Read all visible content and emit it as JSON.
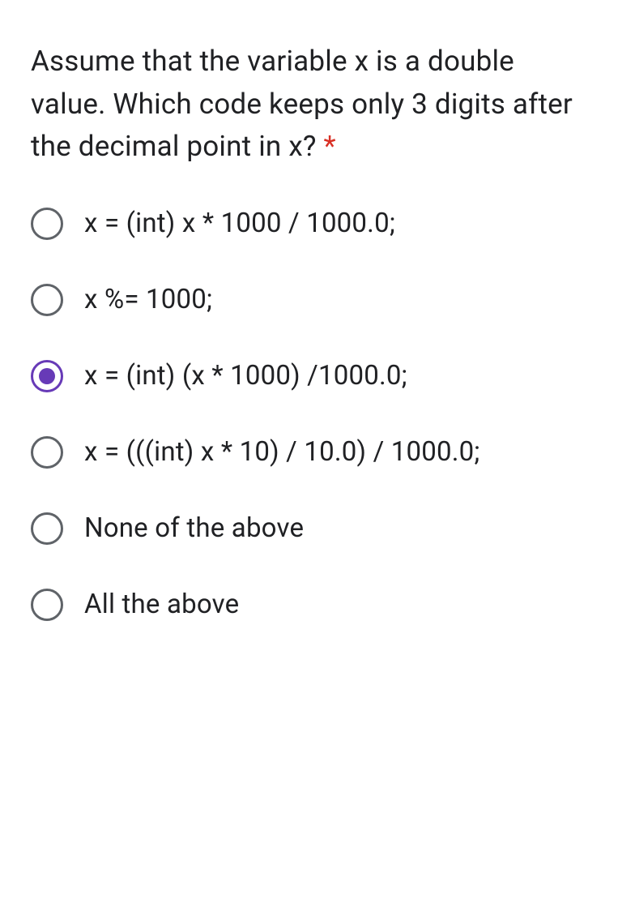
{
  "question": {
    "text": "Assume that the variable x is a double value. Which code keeps only 3 digits after the decimal point in x?",
    "required_marker": "*"
  },
  "options": [
    {
      "label": "x = (int) x * 1000 / 1000.0;",
      "selected": false
    },
    {
      "label": "x %= 1000;",
      "selected": false
    },
    {
      "label": "x = (int) (x * 1000) /1000.0;",
      "selected": true
    },
    {
      "label": "x = (((int) x * 10) / 10.0) / 1000.0;",
      "selected": false
    },
    {
      "label": "None of the above",
      "selected": false
    },
    {
      "label": "All the above",
      "selected": false
    }
  ]
}
